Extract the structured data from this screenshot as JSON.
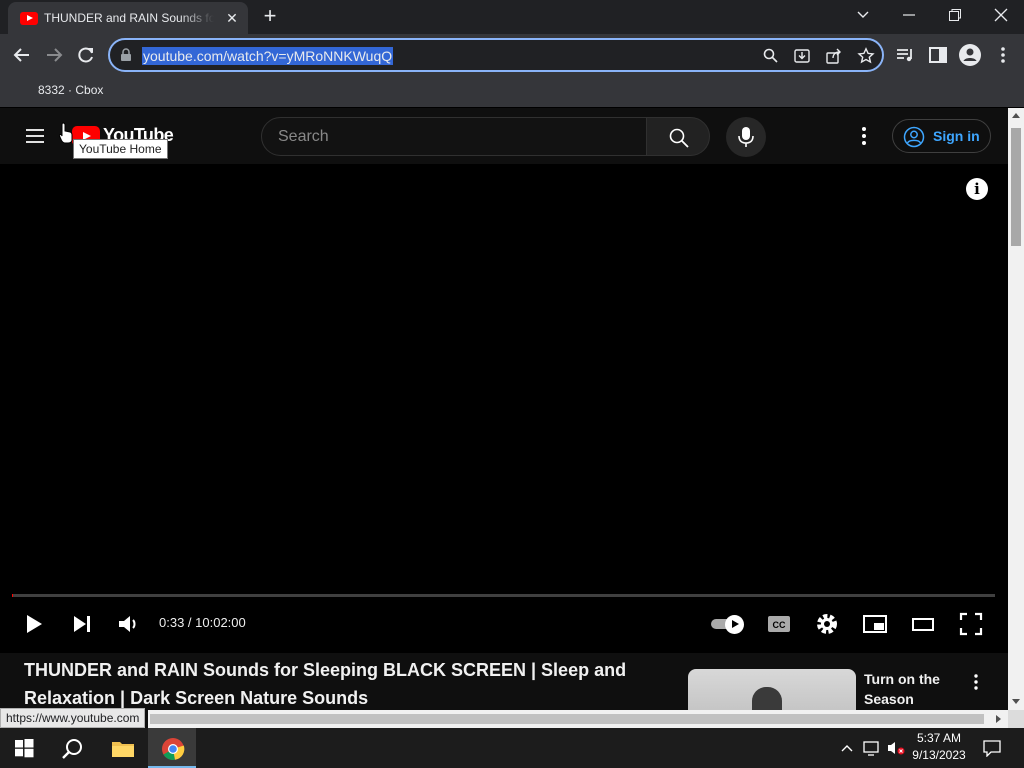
{
  "browser": {
    "tab_title": "THUNDER and RAIN Sounds for Sleeping BLACK SCREEN",
    "tab_close": "✕",
    "new_tab": "+",
    "url": "youtube.com/watch?v=yMRoNNKWuqQ",
    "bookmark": "8332 · Cbox",
    "status_url": "https://www.youtube.com"
  },
  "youtube": {
    "logo_text": "YouTube",
    "logo_tooltip": "YouTube Home",
    "search_placeholder": "Search",
    "sign_in": "Sign in",
    "info_glyph": "i"
  },
  "player": {
    "time": "0:33 / 10:02:00",
    "progress": 0.0009,
    "autoplay": true
  },
  "video": {
    "title": "THUNDER and RAIN Sounds for Sleeping BLACK SCREEN | Sleep and Relaxation | Dark Screen Nature Sounds"
  },
  "recommendation": {
    "title": "Turn on the Season"
  },
  "taskbar": {
    "time": "5:37 AM",
    "date": "9/13/2023"
  },
  "colors": {
    "accent": "#ff0000",
    "link": "#3ea6ff",
    "omnibox_focus": "#8ab4f8"
  }
}
